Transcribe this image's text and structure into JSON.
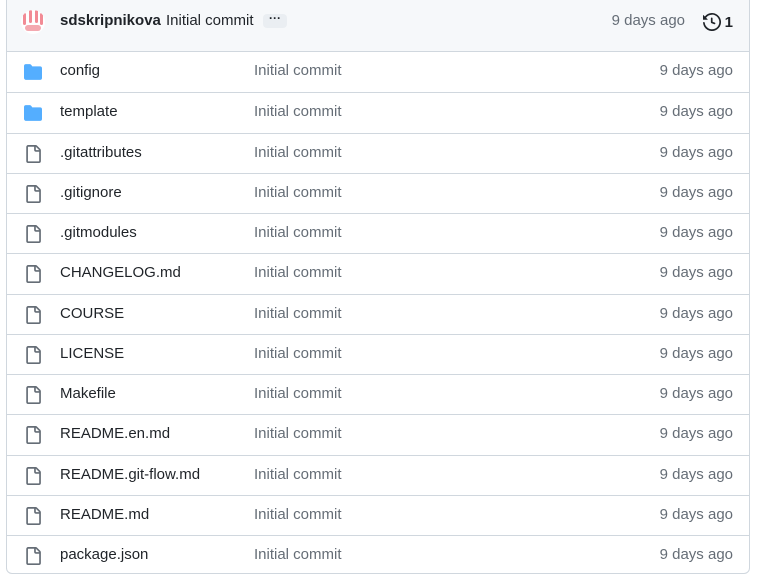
{
  "latest_commit": {
    "author": "sdskripnikova",
    "message": "Initial commit",
    "ellipsis": "···",
    "time": "9 days ago",
    "history_count": "1"
  },
  "files": [
    {
      "name": "config",
      "type": "folder",
      "commit": "Initial commit",
      "age": "9 days ago"
    },
    {
      "name": "template",
      "type": "folder",
      "commit": "Initial commit",
      "age": "9 days ago"
    },
    {
      "name": ".gitattributes",
      "type": "file",
      "commit": "Initial commit",
      "age": "9 days ago"
    },
    {
      "name": ".gitignore",
      "type": "file",
      "commit": "Initial commit",
      "age": "9 days ago"
    },
    {
      "name": ".gitmodules",
      "type": "file",
      "commit": "Initial commit",
      "age": "9 days ago"
    },
    {
      "name": "CHANGELOG.md",
      "type": "file",
      "commit": "Initial commit",
      "age": "9 days ago"
    },
    {
      "name": "COURSE",
      "type": "file",
      "commit": "Initial commit",
      "age": "9 days ago"
    },
    {
      "name": "LICENSE",
      "type": "file",
      "commit": "Initial commit",
      "age": "9 days ago"
    },
    {
      "name": "Makefile",
      "type": "file",
      "commit": "Initial commit",
      "age": "9 days ago"
    },
    {
      "name": "README.en.md",
      "type": "file",
      "commit": "Initial commit",
      "age": "9 days ago"
    },
    {
      "name": "README.git-flow.md",
      "type": "file",
      "commit": "Initial commit",
      "age": "9 days ago"
    },
    {
      "name": "README.md",
      "type": "file",
      "commit": "Initial commit",
      "age": "9 days ago"
    },
    {
      "name": "package.json",
      "type": "file",
      "commit": "Initial commit",
      "age": "9 days ago"
    }
  ],
  "colors": {
    "folder": "#54aeff",
    "file_icon": "#656d76",
    "avatar_stripes": "#f28b95",
    "border": "#d0d7de",
    "header_bg": "#f6f8fa"
  },
  "icons": {
    "folder": "folder-icon",
    "file": "file-icon",
    "history": "history-icon"
  }
}
